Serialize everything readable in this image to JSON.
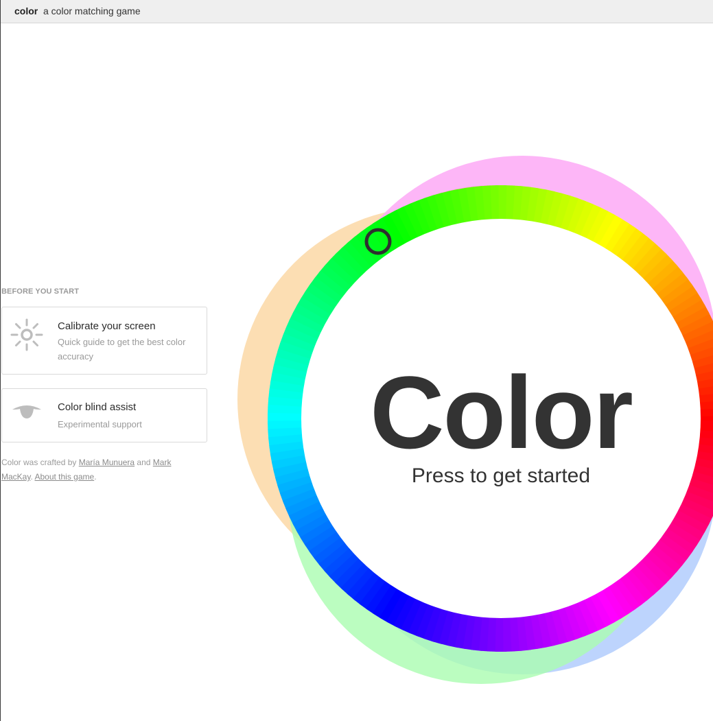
{
  "app": {
    "brand": "color",
    "tagline": "a color matching game"
  },
  "sidebar": {
    "heading": "BEFORE YOU START",
    "cards": [
      {
        "title": "Calibrate your screen",
        "description": "Quick guide to get the best color accuracy",
        "icon": "sun-icon"
      },
      {
        "title": "Color blind assist",
        "description": "Experimental support",
        "icon": "eye-icon"
      }
    ],
    "credits": {
      "prefix": "Color was crafted by ",
      "author1": "María Munuera",
      "conjunction": " and ",
      "author2": "Mark MacKay",
      "separator": ". ",
      "about": "About this game",
      "suffix": "."
    }
  },
  "hero": {
    "title": "Color",
    "subtitle": "Press to get started"
  },
  "colors": {
    "orange_halo": "#fcd8a6",
    "pink_halo": "#fdaef6",
    "blue_halo": "#b1cdfd",
    "green_halo": "#aafcb0",
    "text_dark": "#333333",
    "muted_text": "#9a9a9a",
    "picker_ring": "#2f2f2f"
  },
  "picker": {
    "hue_degrees": 120
  }
}
